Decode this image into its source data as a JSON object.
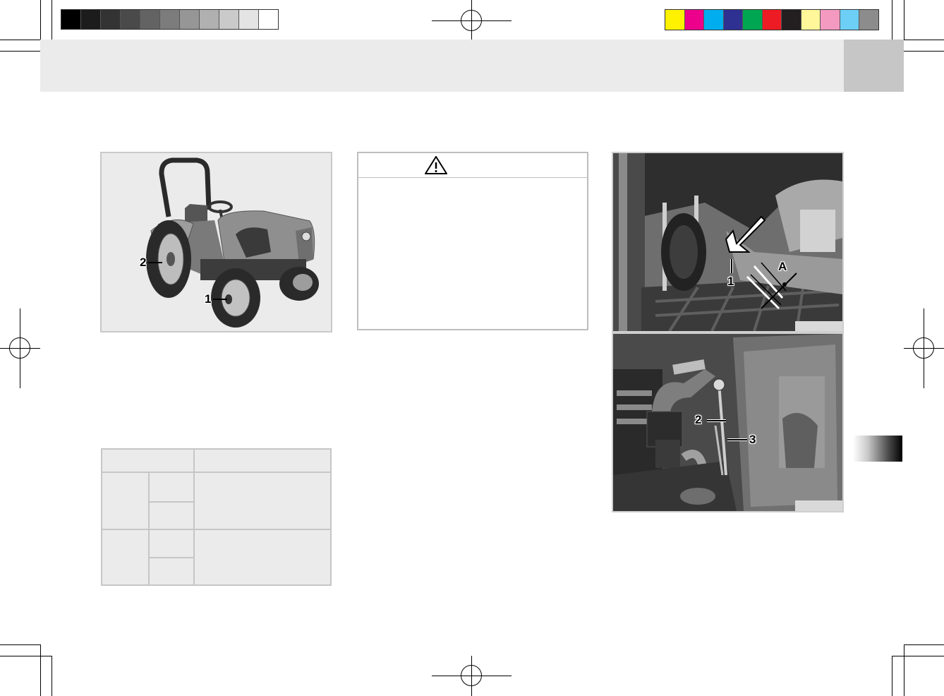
{
  "print_marks": {
    "grayscale_swatches": [
      "#000000",
      "#1c1c1c",
      "#333333",
      "#4a4a4a",
      "#636363",
      "#7c7c7c",
      "#969696",
      "#b0b0b0",
      "#cacaca",
      "#e4e4e4",
      "#ffffff"
    ],
    "color_swatches": [
      "#fff200",
      "#ec008c",
      "#00aeef",
      "#2e3192",
      "#00a651",
      "#ed1c24",
      "#231f20",
      "#fff799",
      "#f49ac1",
      "#6dcff6",
      "#8c8c8c"
    ]
  },
  "figure_tractor": {
    "callouts": [
      "2",
      "1"
    ]
  },
  "warning_box": {
    "icon": "warning-triangle-icon"
  },
  "figure_pedal": {
    "callouts": [
      "A",
      "1"
    ]
  },
  "figure_engine": {
    "callouts": [
      "2",
      "3"
    ]
  }
}
